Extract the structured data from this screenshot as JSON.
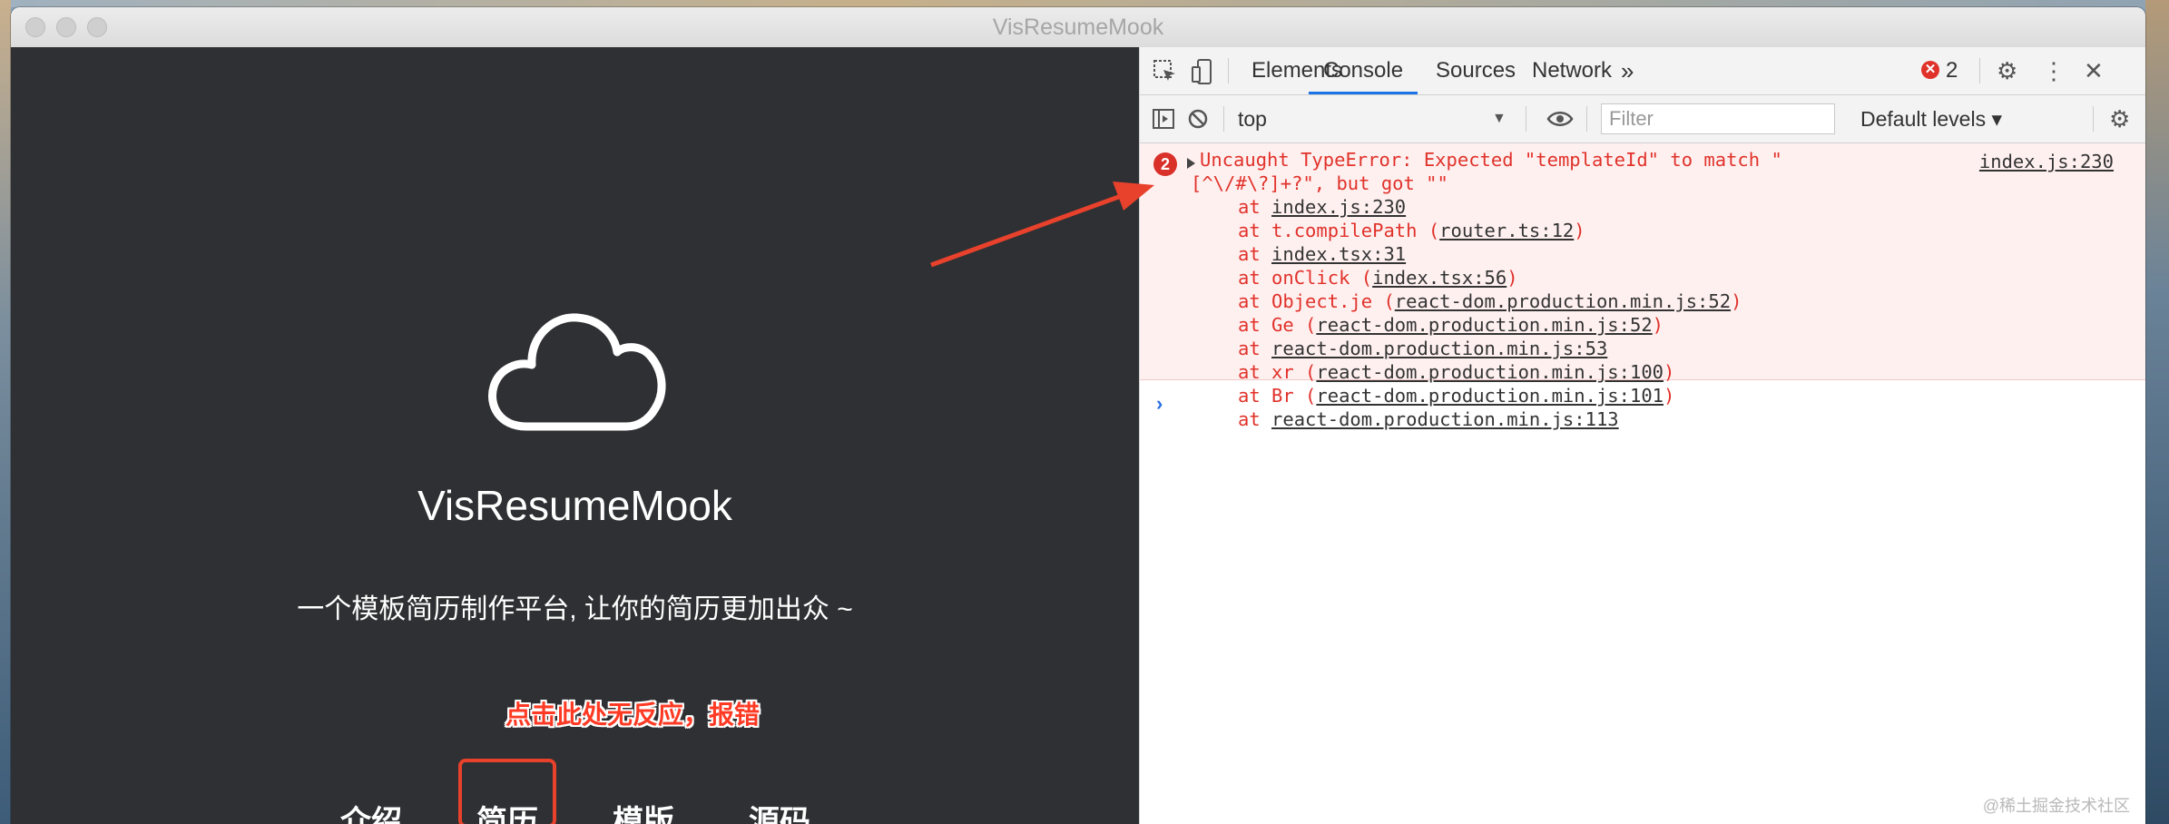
{
  "window": {
    "title": "VisResumeMook"
  },
  "app": {
    "title": "VisResumeMook",
    "subtitle": "一个模板简历制作平台, 让你的简历更加出众 ~",
    "annotation": "点击此处无反应，报错",
    "nav": [
      "介绍",
      "简历",
      "模版",
      "源码"
    ]
  },
  "devtools": {
    "tabs": [
      "Elements",
      "Console",
      "Sources",
      "Network"
    ],
    "active_tab": "Console",
    "more_tabs": "»",
    "error_count": "2",
    "context": "top",
    "filter_placeholder": "Filter",
    "levels": "Default levels ▾",
    "error": {
      "count": "2",
      "message_line1": "Uncaught TypeError: Expected \"templateId\" to match \"",
      "message_line2": "[^\\/#\\?]+?\", but got \"\"",
      "source": "index.js:230",
      "stack": [
        {
          "prefix": "at ",
          "fn": "",
          "link": "index.js:230"
        },
        {
          "prefix": "at ",
          "fn": "t.compilePath (",
          "link": "router.ts:12",
          "suffix": ")"
        },
        {
          "prefix": "at ",
          "fn": "",
          "link": "index.tsx:31"
        },
        {
          "prefix": "at ",
          "fn": "onClick (",
          "link": "index.tsx:56",
          "suffix": ")"
        },
        {
          "prefix": "at ",
          "fn": "Object.je (",
          "link": "react-dom.production.min.js:52",
          "suffix": ")"
        },
        {
          "prefix": "at ",
          "fn": "Ge (",
          "link": "react-dom.production.min.js:52",
          "suffix": ")"
        },
        {
          "prefix": "at ",
          "fn": "",
          "link": "react-dom.production.min.js:53"
        },
        {
          "prefix": "at ",
          "fn": "xr (",
          "link": "react-dom.production.min.js:100",
          "suffix": ")"
        },
        {
          "prefix": "at ",
          "fn": "Br (",
          "link": "react-dom.production.min.js:101",
          "suffix": ")"
        },
        {
          "prefix": "at ",
          "fn": "",
          "link": "react-dom.production.min.js:113"
        }
      ]
    },
    "prompt": "›"
  },
  "watermark": "@稀土掘金技术社区",
  "colors": {
    "app_bg": "#2f3033",
    "error_red": "#e0322a",
    "annotation_red": "#ff3a24",
    "arrow_red": "#e8412c"
  }
}
